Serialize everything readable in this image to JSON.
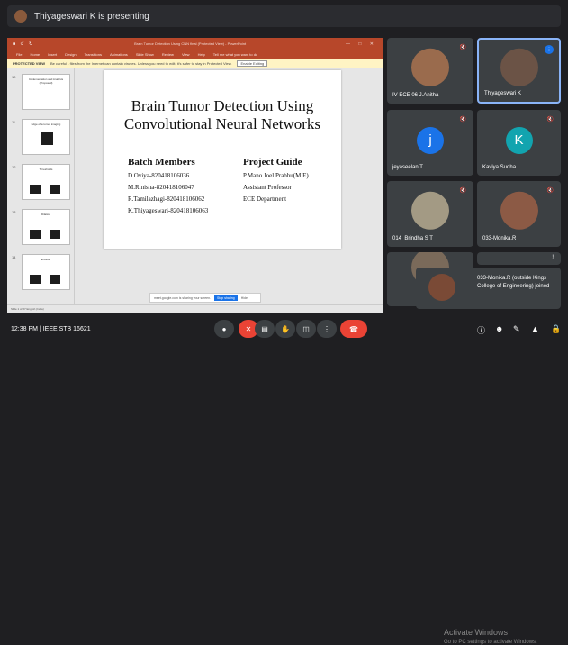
{
  "presenting": {
    "text": "Thiyageswari K is presenting"
  },
  "powerpoint": {
    "title_bar": "Brain Tumor Detection Using CNN final (Protected View) - PowerPoint",
    "menu": [
      "File",
      "Home",
      "Insert",
      "Design",
      "Transitions",
      "Animations",
      "Slide Show",
      "Review",
      "View",
      "Help",
      "Tell me what you want to do"
    ],
    "protected_label": "PROTECTED VIEW",
    "protected_msg": "Be careful - files from the Internet can contain viruses. Unless you need to edit, it's safer to stay in Protected View.",
    "enable_editing": "Enable Editing",
    "thumbnails": [
      {
        "num": "10",
        "title": "Implementation and Analysis (Proposed)"
      },
      {
        "num": "11",
        "title": "Edge of a tumor imaging"
      },
      {
        "num": "12",
        "title": "Thresholds"
      },
      {
        "num": "13",
        "title": "Dilation"
      },
      {
        "num": "14",
        "title": "Erosion"
      }
    ],
    "slide": {
      "title_line1": "Brain Tumor Detection Using",
      "title_line2": "Convolutional Neural Networks",
      "members_heading": "Batch Members",
      "members": [
        "D.Oviya-820418106036",
        "M.Rinisha-820418106047",
        "R.Tamilazhagi-820418106062",
        "K.Thiyageswari-820418106063"
      ],
      "guide_heading": "Project Guide",
      "guide": [
        "P.Mano Joel Prabhu(M.E)",
        "Assistant Professor",
        "ECE Department"
      ]
    },
    "share_notice": "meet.google.com is sharing your screen.",
    "stop_sharing": "Stop sharing",
    "hide": "Hide",
    "status": "Slide 1 of 27   English (India)"
  },
  "participants": [
    {
      "name": "IV ECE 06 J.Anitha"
    },
    {
      "name": "Thiyageswari K"
    },
    {
      "name": "jeyaseelan T",
      "letter": "j",
      "color": "#1a73e8"
    },
    {
      "name": "Kaviya Sudha",
      "letter": "K",
      "color": "#12a4af"
    },
    {
      "name": "014_Brindha S T"
    },
    {
      "name": "033-Monika.R"
    }
  ],
  "toast": {
    "text": "033-Monika.R (outside Kings College of Engineering) joined"
  },
  "meeting": {
    "time": "12:38 PM",
    "separator": "|",
    "code": "IEEE STB 16621"
  },
  "watermark": {
    "line1": "Activate Windows",
    "line2": "Go to PC settings to activate Windows."
  },
  "icons": {
    "mic": "mic-icon",
    "camera": "camera-off-icon",
    "captions": "captions-icon",
    "hand": "raise-hand-icon",
    "present": "present-icon",
    "more": "more-icon",
    "end": "end-call-icon",
    "info": "info-icon",
    "people": "people-icon",
    "chat": "chat-icon",
    "activities": "activities-icon",
    "lock": "lock-icon"
  }
}
